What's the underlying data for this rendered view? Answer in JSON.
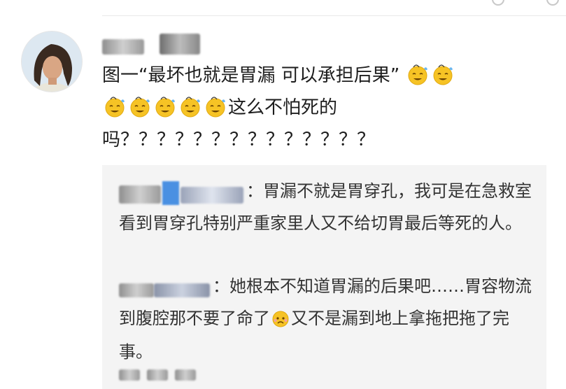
{
  "comment": {
    "text_before": "图一“最坏也就是胃漏 可以承担后果”",
    "text_after": "这么不怕死的吗？？？？？？？？？？？？？？"
  },
  "replies": [
    {
      "text": "：胃漏不就是胃穿孔，我可是在急救室看到胃穿孔特别严重家里人又不给切胃最后等死的人。"
    },
    {
      "text_before": "：她根本不知道胃漏的后果吧……胃容物流到腹腔那不要了命了",
      "text_after": "又不是漏到地上拿拖把拖了完事。"
    }
  ],
  "emoji": {
    "face": "dizzy-sweat-face-emoji",
    "face_color": "#f6c325",
    "sweat_color": "#6ab6f0"
  }
}
